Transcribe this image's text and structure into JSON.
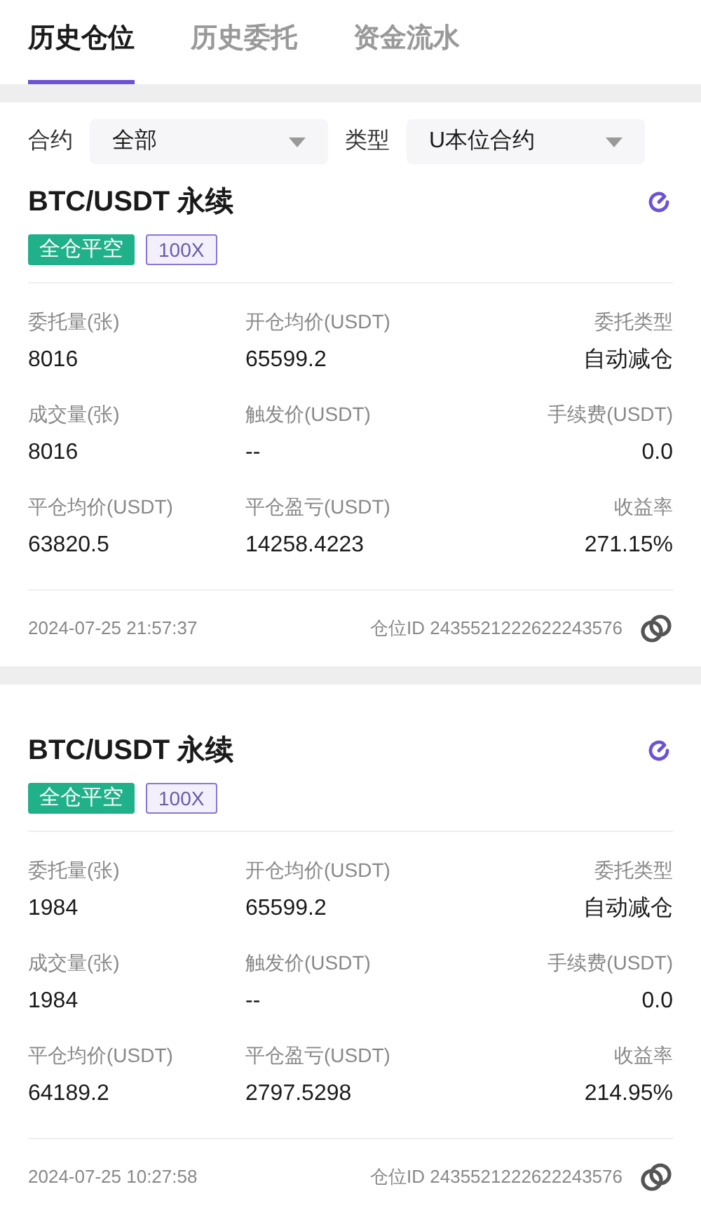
{
  "tabs": [
    {
      "label": "历史仓位",
      "selected": true
    },
    {
      "label": "历史委托",
      "selected": false
    },
    {
      "label": "资金流水",
      "selected": false
    }
  ],
  "filters": [
    {
      "label": "合约",
      "value": "全部"
    },
    {
      "label": "类型",
      "value": "U本位合约"
    }
  ],
  "positions": [
    {
      "title": "BTC/USDT 永续",
      "tag": "全仓平空",
      "leverage": "100X",
      "fields": [
        [
          {
            "label": "委托量(张)",
            "value": "8016"
          },
          {
            "label": "开仓均价(USDT)",
            "value": "65599.2"
          },
          {
            "label": "委托类型",
            "value": "自动减仓"
          }
        ],
        [
          {
            "label": "成交量(张)",
            "value": "8016"
          },
          {
            "label": "触发价(USDT)",
            "value": "--"
          },
          {
            "label": "手续费(USDT)",
            "value": "0.0"
          }
        ],
        [
          {
            "label": "平仓均价(USDT)",
            "value": "63820.5"
          },
          {
            "label": "平仓盈亏(USDT)",
            "value": "14258.4223"
          },
          {
            "label": "收益率",
            "value": "271.15%"
          }
        ]
      ],
      "time": "2024-07-25 21:57:37",
      "position_id": "仓位ID 2435521222622243576"
    },
    {
      "title": "BTC/USDT 永续",
      "tag": "全仓平空",
      "leverage": "100X",
      "fields": [
        [
          {
            "label": "委托量(张)",
            "value": "1984"
          },
          {
            "label": "开仓均价(USDT)",
            "value": "65599.2"
          },
          {
            "label": "委托类型",
            "value": "自动减仓"
          }
        ],
        [
          {
            "label": "成交量(张)",
            "value": "1984"
          },
          {
            "label": "触发价(USDT)",
            "value": "--"
          },
          {
            "label": "手续费(USDT)",
            "value": "0.0"
          }
        ],
        [
          {
            "label": "平仓均价(USDT)",
            "value": "64189.2"
          },
          {
            "label": "平仓盈亏(USDT)",
            "value": "2797.5298"
          },
          {
            "label": "收益率",
            "value": "214.95%"
          }
        ]
      ],
      "time": "2024-07-25 10:27:58",
      "position_id": "仓位ID 2435521222622243576"
    }
  ]
}
